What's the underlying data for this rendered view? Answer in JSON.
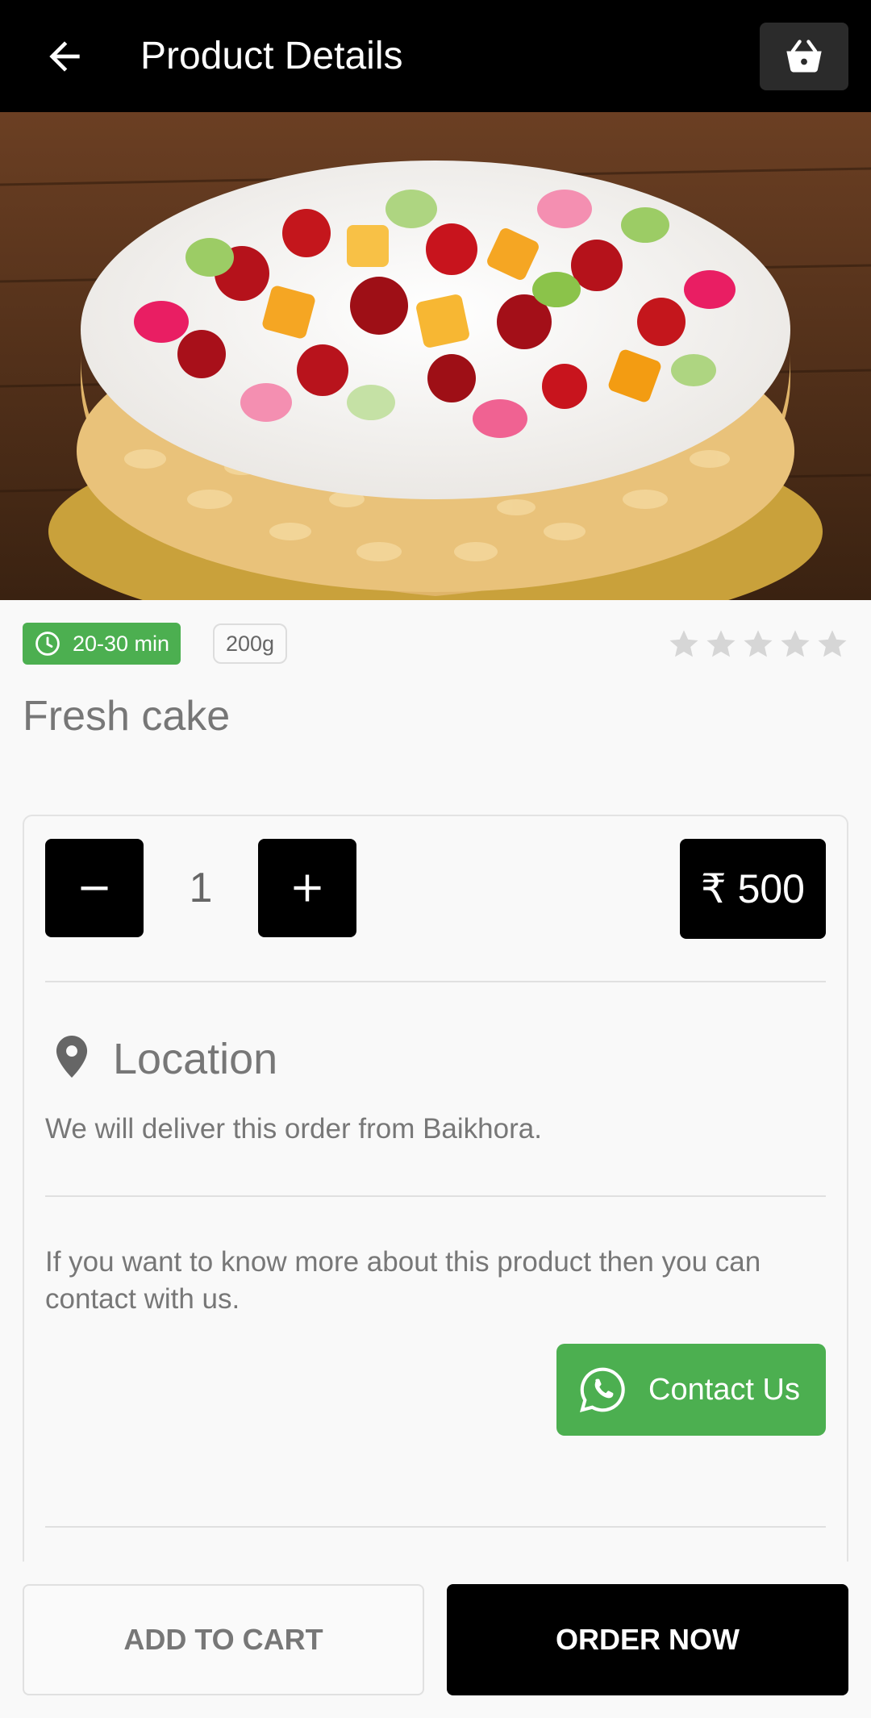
{
  "header": {
    "title": "Product Details",
    "back_icon": "arrow-left-icon",
    "cart_icon": "basket-icon"
  },
  "hero": {
    "image": "fruit cake photo"
  },
  "meta": {
    "delivery_time": "20-30 min",
    "weight": "200g",
    "rating": 0,
    "rating_max": 5
  },
  "product": {
    "name": "Fresh cake"
  },
  "order": {
    "quantity": "1",
    "price": "₹ 500"
  },
  "location": {
    "title": "Location",
    "text": "We will deliver this order from Baikhora."
  },
  "contact": {
    "info": "If you want to know more about this product then you can contact with us.",
    "button_label": "Contact Us"
  },
  "actions": {
    "add_to_cart": "ADD TO CART",
    "order_now": "ORDER NOW"
  },
  "colors": {
    "primary": "#000000",
    "accent": "#4caf50",
    "text": "#777777"
  }
}
